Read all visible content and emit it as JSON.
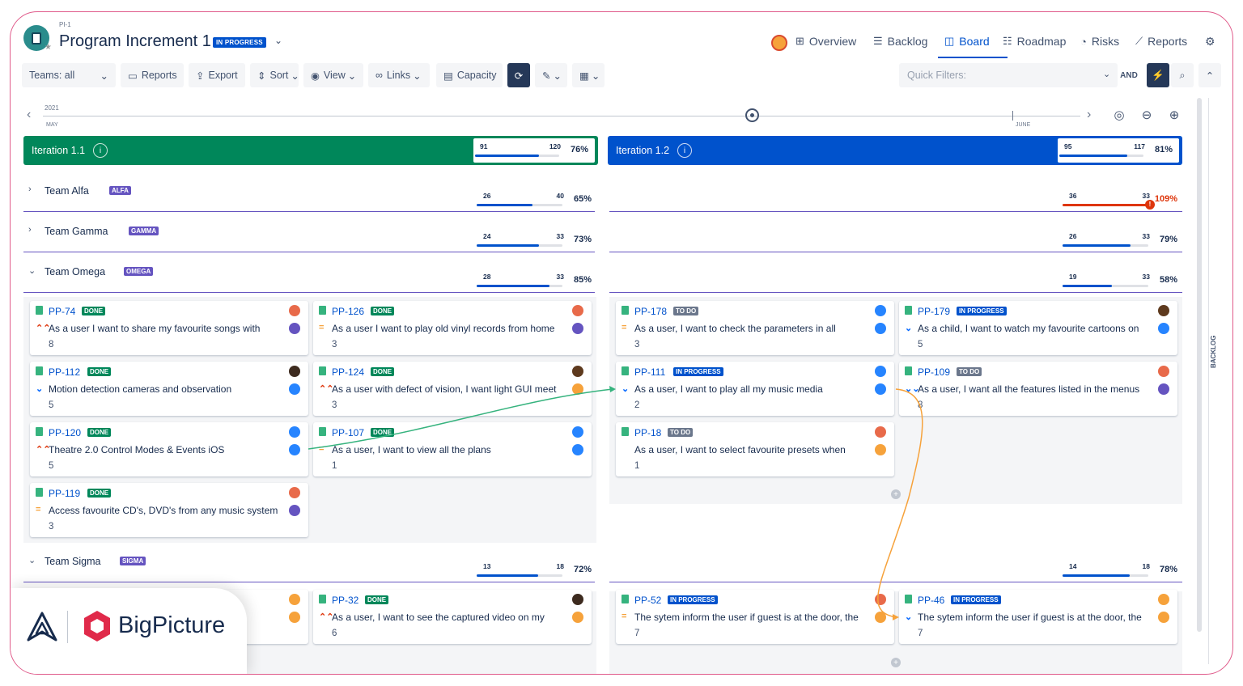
{
  "header": {
    "pi_label": "PI-1",
    "title": "Program Increment 1",
    "status": "IN PROGRESS",
    "nav": [
      {
        "label": "Overview",
        "icon": "hierarchy-icon"
      },
      {
        "label": "Backlog",
        "icon": "list-icon"
      },
      {
        "label": "Board",
        "icon": "board-icon",
        "active": true
      },
      {
        "label": "Roadmap",
        "icon": "roadmap-icon"
      },
      {
        "label": "Risks",
        "icon": "risk-icon"
      },
      {
        "label": "Reports",
        "icon": "chart-icon"
      }
    ]
  },
  "toolbar": {
    "teams": "Teams: all",
    "reports": "Reports",
    "export": "Export",
    "sort": "Sort",
    "view": "View",
    "links": "Links",
    "capacity": "Capacity",
    "quick_filters_placeholder": "Quick Filters:",
    "and": "AND"
  },
  "timeline": {
    "year": "2021",
    "month_start": "MAY",
    "month_mid": "JUNE"
  },
  "iterations": [
    {
      "name": "Iteration 1.1",
      "a": "91",
      "b": "120",
      "pct": "76%",
      "fill": 0.76,
      "color": "#00875a"
    },
    {
      "name": "Iteration 1.2",
      "a": "95",
      "b": "117",
      "pct": "81%",
      "fill": 0.81,
      "color": "#0052cc"
    }
  ],
  "teams": [
    {
      "name": "Team Alfa",
      "tag": "ALFA",
      "i1": {
        "a": "26",
        "b": "40",
        "pct": "65%",
        "fill": 0.65
      },
      "i2": {
        "a": "36",
        "b": "33",
        "pct": "109%",
        "fill": 1.0,
        "over": true
      }
    },
    {
      "name": "Team Gamma",
      "tag": "GAMMA",
      "i1": {
        "a": "24",
        "b": "33",
        "pct": "73%",
        "fill": 0.73
      },
      "i2": {
        "a": "26",
        "b": "33",
        "pct": "79%",
        "fill": 0.79
      }
    },
    {
      "name": "Team Omega",
      "tag": "OMEGA",
      "i1": {
        "a": "28",
        "b": "33",
        "pct": "85%",
        "fill": 0.85
      },
      "i2": {
        "a": "19",
        "b": "33",
        "pct": "58%",
        "fill": 0.58
      }
    },
    {
      "name": "Team Sigma",
      "tag": "SIGMA",
      "i1": {
        "a": "13",
        "b": "18",
        "pct": "72%",
        "fill": 0.72
      },
      "i2": {
        "a": "14",
        "b": "18",
        "pct": "78%",
        "fill": 0.78
      }
    }
  ],
  "cards": [
    {
      "key": "PP-74",
      "status": "DONE",
      "summary": "As a user I want to share my favourite songs with",
      "points": "8",
      "prio": "high",
      "av1": "#e86a4a",
      "av2": "#6554c0"
    },
    {
      "key": "PP-126",
      "status": "DONE",
      "summary": "As a user I want to play old vinyl records from home",
      "points": "3",
      "prio": "medium",
      "av1": "#e86a4a",
      "av2": "#6554c0"
    },
    {
      "key": "PP-178",
      "status": "TO DO",
      "summary": "As a user, I want to check the parameters in all",
      "points": "3",
      "prio": "medium",
      "av1": "#2684ff",
      "av2": "#2684ff"
    },
    {
      "key": "PP-179",
      "status": "IN PROGRESS",
      "summary": "As a child, I want to watch my favourite cartoons on",
      "points": "5",
      "prio": "low",
      "av1": "#5e3a1e",
      "av2": "#2684ff"
    },
    {
      "key": "PP-112",
      "status": "DONE",
      "summary": "Motion detection cameras and observation",
      "points": "5",
      "prio": "low",
      "av1": "#3d2b1f",
      "av2": "#2684ff"
    },
    {
      "key": "PP-124",
      "status": "DONE",
      "summary": "As a user with defect of vision, I want light GUI meet",
      "points": "3",
      "prio": "high",
      "av1": "#5e3a1e",
      "av2": "#f6a23b"
    },
    {
      "key": "PP-111",
      "status": "IN PROGRESS",
      "summary": "As a user, I want to play all my music media",
      "points": "2",
      "prio": "low",
      "av1": "#2684ff",
      "av2": "#2684ff"
    },
    {
      "key": "PP-109",
      "status": "TO DO",
      "summary": "As a user, I want all the features listed in the menus",
      "points": "8",
      "prio": "lowest",
      "av1": "#e86a4a",
      "av2": "#6554c0"
    },
    {
      "key": "PP-120",
      "status": "DONE",
      "summary": "Theatre 2.0 Control Modes & Events iOS",
      "points": "5",
      "prio": "high",
      "av1": "#2684ff",
      "av2": "#2684ff"
    },
    {
      "key": "PP-107",
      "status": "DONE",
      "summary": "As a user, I want to view all the plans",
      "points": "1",
      "prio": "medium",
      "av1": "#2684ff",
      "av2": "#2684ff"
    },
    {
      "key": "PP-18",
      "status": "TO DO",
      "summary": "As a user, I want to select favourite presets when",
      "points": "1",
      "prio": "none",
      "av1": "#e86a4a",
      "av2": "#f6a23b"
    },
    {
      "key": "PP-119",
      "status": "DONE",
      "summary": "Access favourite CD's, DVD's from any music system",
      "points": "3",
      "prio": "medium",
      "av1": "#e86a4a",
      "av2": "#6554c0"
    },
    {
      "key": "PP-32",
      "status": "DONE",
      "summary": "As a user, I want to see the captured video on my",
      "points": "6",
      "prio": "high",
      "av1": "#3d2b1f",
      "av2": "#f6a23b"
    },
    {
      "key": "PP-52",
      "status": "IN PROGRESS",
      "summary": "The sytem inform the user if guest is at the door, the",
      "points": "7",
      "prio": "medium",
      "av1": "#e86a4a",
      "av2": "#f6a23b"
    },
    {
      "key": "PP-46",
      "status": "IN PROGRESS",
      "summary": "The sytem inform the user if guest is at the door, the",
      "points": "7",
      "prio": "low",
      "av1": "#f6a23b",
      "av2": "#f6a23b"
    },
    {
      "key": "",
      "status": "",
      "summary": "",
      "points": "",
      "prio": "none",
      "av1": "#f6a23b",
      "av2": "#f6a23b"
    }
  ],
  "sidebar": {
    "backlog_label": "BACKLOG"
  },
  "brand": {
    "name": "BigPicture"
  }
}
